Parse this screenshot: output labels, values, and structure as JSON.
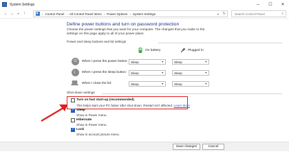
{
  "window": {
    "title": "System Settings",
    "minimize": "─",
    "maximize": "☐",
    "close": "✕"
  },
  "nav": {
    "back": "←",
    "forward": "→",
    "up": "↑",
    "breadcrumb": [
      "Control Panel",
      "All Control Panel Items",
      "Power Options",
      "System Settings"
    ],
    "search_placeholder": "Search Control Panel"
  },
  "page": {
    "heading": "Define power buttons and turn on password protection",
    "intro_text": "Choose the power settings that you want for your computer. The changes that you make to the settings on this page apply to all of your power plans.",
    "sections": {
      "buttons": "Power and sleep buttons and lid settings",
      "shutdown": "Shut-down settings"
    },
    "columns": {
      "battery": "On battery",
      "plugged": "Plugged in"
    },
    "rows": [
      {
        "label": "When I press the power button:",
        "battery": "Sleep",
        "plugged": "Sleep",
        "icon": "power-icon"
      },
      {
        "label": "When I press the sleep button:",
        "battery": "Sleep",
        "plugged": "Sleep",
        "icon": "moon-icon"
      },
      {
        "label": "When I close the lid:",
        "battery": "Sleep",
        "plugged": "Sleep",
        "icon": "laptop-icon"
      }
    ],
    "shutdown_options": [
      {
        "title": "Turn on fast start-up (recommended)",
        "description": "This helps start your PC faster after shut-down. Restart isn't affected.",
        "link": "Learn More",
        "checked": false
      },
      {
        "title": "Sleep",
        "description": "Show in Power menu.",
        "checked": true
      },
      {
        "title": "Hibernate",
        "description": "Show in Power menu.",
        "checked": false
      },
      {
        "title": "Lock",
        "description": "Show in account picture menu.",
        "checked": true
      }
    ]
  },
  "footer": {
    "save": "Save changes",
    "cancel": "Cancel"
  },
  "colors": {
    "heading": "#1e3287",
    "highlight": "#e01e1e",
    "link": "#2c64c8"
  }
}
